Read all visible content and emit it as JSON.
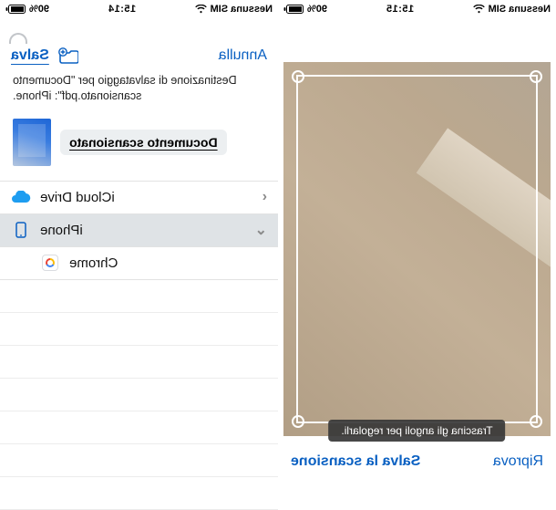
{
  "status": {
    "carrier": "Nessuna SIM",
    "time_left": "15:15",
    "time_right": "15:14",
    "battery": "90%"
  },
  "scan": {
    "hint": "Trascina gli angoli per regolarli.",
    "retry_label": "Riprova",
    "save_label": "Salva la scansione"
  },
  "dialog": {
    "cancel_label": "Annulla",
    "save_label": "Salva",
    "destination_line1": "Destinazione di salvataggio per \"Documento",
    "destination_line2": "scansionato.pdf\": iPhone.",
    "filename": "Documento scansionato"
  },
  "locations": {
    "icloud": "iCloud Drive",
    "iphone": "iPhone",
    "chrome": "Chrome"
  },
  "icons": {
    "wifi": "wifi-icon",
    "battery": "battery-icon",
    "folder_plus": "folder-plus-icon",
    "cloud": "cloud-icon",
    "phone": "phone-icon",
    "chrome": "chrome-icon",
    "chevron_left": "chevron-left-icon",
    "chevron_down": "chevron-down-icon"
  }
}
